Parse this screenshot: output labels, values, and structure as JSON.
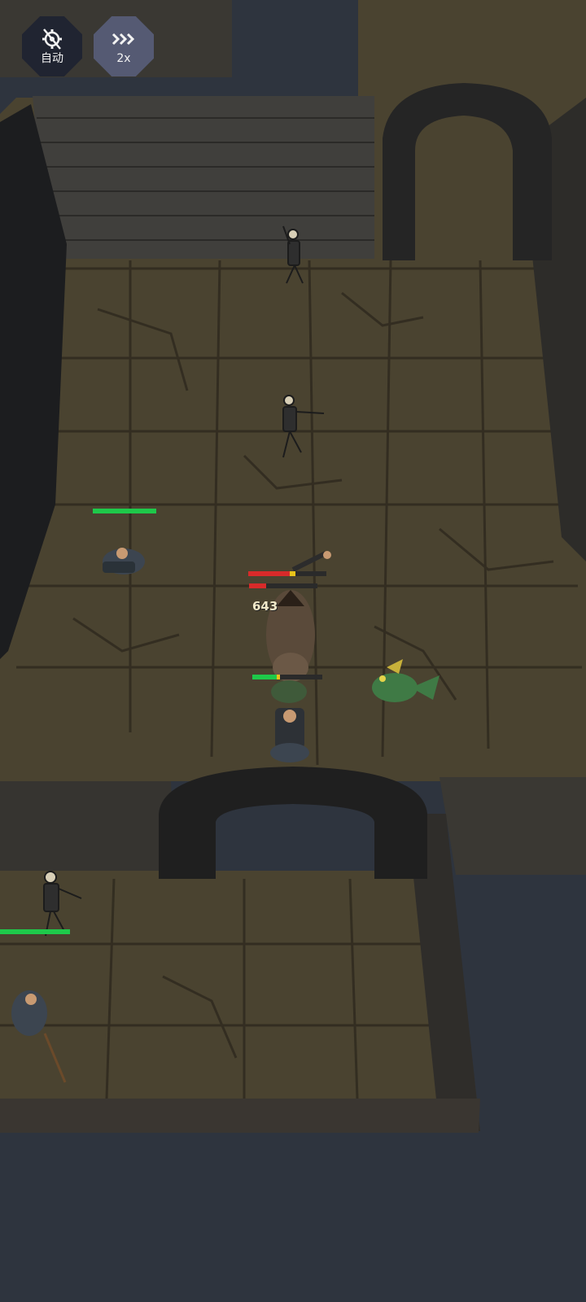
{
  "hud": {
    "auto_label": "自动",
    "speed_label": "2x"
  },
  "combat": {
    "damage_text": "643"
  },
  "health": {
    "ally_left": 1.0,
    "boss": 0.6,
    "boss_secondary": 0.25,
    "hero": 0.4,
    "ally_bottom_left": 1.0
  },
  "colors": {
    "hp_green": "#1ec94a",
    "hp_red": "#d82a2a",
    "hp_yellow": "#e8c21a",
    "floor": "#4a4330",
    "wall": "#3b3b3b",
    "void": "#2e343e"
  }
}
